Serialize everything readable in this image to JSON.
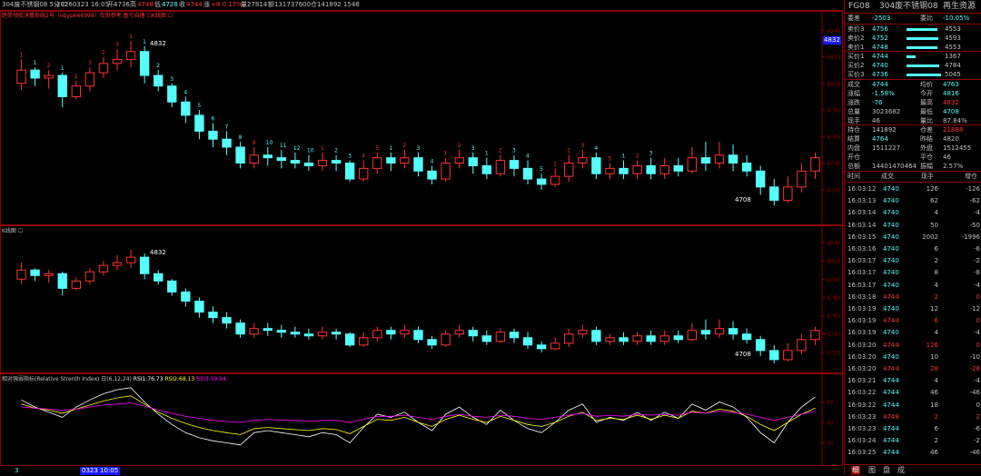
{
  "topbar": {
    "title": "304废不锈钢08 5分 ☐",
    "date": "20260323 16:05",
    "open": "开4736",
    "high_label": "高",
    "high": "4748",
    "low_label": "低",
    "low": "4728",
    "close_label": "收",
    "close": "4744",
    "change_label": "涨",
    "change": "+8 0.17%",
    "volume": "量27814",
    "amount": "额131737600",
    "oi": "仓141892 1548"
  },
  "panel1": {
    "legend": "趋势领航决策系统2号（nbyp666999）仅供参考 盈亏自理 ☐K线图 ☐",
    "high_mark": "4832",
    "low_mark": "4708",
    "current_price": "4832"
  },
  "panel2": {
    "legend": "K线图 ☐",
    "high_mark": "4832",
    "low_mark": "4708"
  },
  "panel3": {
    "legend_name": "相对强弱指标(Relative Strenth Index) 日(6,12,24)",
    "rsi1": "RSI1:76.73",
    "rsi2": "RSI2:68.13",
    "rsi3": "RSI3:59.94"
  },
  "xaxis": {
    "start_label": "3",
    "date_tag": "0323 10:05"
  },
  "colors": {
    "up": "#ff3232",
    "down": "#54ffff",
    "rsi1": "#ffffff",
    "rsi2": "#ffff00",
    "rsi3": "#ff00ff",
    "grid": "#8b0000",
    "text_red": "#ff3232",
    "text_cyan": "#54ffff"
  },
  "side": {
    "code": "FG08",
    "name": "304废不锈钢08",
    "category": "再生资源",
    "wei_cha_label": "委差",
    "wei_cha": "-2503",
    "wei_bi_label": "委比",
    "wei_bi": "-10.05%",
    "asks": [
      {
        "label": "卖价3",
        "price": "4756",
        "vol": "4553"
      },
      {
        "label": "卖价2",
        "price": "4752",
        "vol": "4593"
      },
      {
        "label": "卖价1",
        "price": "4748",
        "vol": "4553"
      }
    ],
    "bids": [
      {
        "label": "买价1",
        "price": "4744",
        "vol": "1367"
      },
      {
        "label": "买价2",
        "price": "4740",
        "vol": "4784"
      },
      {
        "label": "买价3",
        "price": "4736",
        "vol": "5045"
      }
    ],
    "stats": [
      {
        "l1": "成交",
        "v1": "4744",
        "c1": "cyan",
        "l2": "均价",
        "v2": "4763",
        "c2": "cyan"
      },
      {
        "l1": "涨幅",
        "v1": "-1.58%",
        "c1": "cyan",
        "l2": "今开",
        "v2": "4816",
        "c2": "cyan"
      },
      {
        "l1": "涨跌",
        "v1": "-76",
        "c1": "cyan",
        "l2": "最高",
        "v2": "4832",
        "c2": "red"
      },
      {
        "l1": "总量",
        "v1": "3023682",
        "c1": "grey",
        "l2": "最低",
        "v2": "4708",
        "c2": "cyan"
      },
      {
        "l1": "现手",
        "v1": "46",
        "c1": "grey",
        "l2": "量比",
        "v2": "87.84%",
        "c2": "grey"
      }
    ],
    "stats2": [
      {
        "l1": "持仓",
        "v1": "141892",
        "c1": "grey",
        "l2": "仓差",
        "v2": "21888",
        "c2": "red"
      },
      {
        "l1": "结算",
        "v1": "4764",
        "c1": "cyan",
        "l2": "昨结",
        "v2": "4820",
        "c2": "grey"
      },
      {
        "l1": "内盘",
        "v1": "1511227",
        "c1": "grey",
        "l2": "外盘",
        "v2": "1512455",
        "c2": "grey"
      },
      {
        "l1": "开仓",
        "v1": "",
        "c1": "grey",
        "l2": "平仓",
        "v2": "46",
        "c2": "grey"
      },
      {
        "l1": "总额",
        "v1": "14401470464",
        "c1": "grey",
        "l2": "振幅",
        "v2": "2.57%",
        "c2": "grey"
      }
    ],
    "ticks_header": {
      "time": "时间",
      "price": "成交",
      "vol": "现手",
      "oi": "增仓"
    },
    "ticks": [
      {
        "time": "16:03:12",
        "price": "4740",
        "vol": "126",
        "oi": "-126",
        "c": "cyan"
      },
      {
        "time": "16:03:13",
        "price": "4740",
        "vol": "62",
        "oi": "-62",
        "c": "cyan"
      },
      {
        "time": "16:03:14",
        "price": "4740",
        "vol": "4",
        "oi": "-4",
        "c": "cyan"
      },
      {
        "time": "16:03:14",
        "price": "4740",
        "vol": "50",
        "oi": "-50",
        "c": "cyan"
      },
      {
        "time": "16:03:15",
        "price": "4740",
        "vol": "2002",
        "oi": "-1996",
        "c": "cyan"
      },
      {
        "time": "16:03:16",
        "price": "4740",
        "vol": "6",
        "oi": "-6",
        "c": "cyan"
      },
      {
        "time": "16:03:17",
        "price": "4740",
        "vol": "2",
        "oi": "-2",
        "c": "cyan"
      },
      {
        "time": "16:03:17",
        "price": "4740",
        "vol": "8",
        "oi": "-8",
        "c": "cyan"
      },
      {
        "time": "16:03:17",
        "price": "4740",
        "vol": "4",
        "oi": "-4",
        "c": "cyan"
      },
      {
        "time": "16:03:18",
        "price": "4744",
        "vol": "2",
        "oi": "0",
        "c": "red"
      },
      {
        "time": "16:03:19",
        "price": "4740",
        "vol": "12",
        "oi": "-12",
        "c": "cyan"
      },
      {
        "time": "16:03:19",
        "price": "4744",
        "vol": "6",
        "oi": "0",
        "c": "red"
      },
      {
        "time": "16:03:19",
        "price": "4740",
        "vol": "4",
        "oi": "-4",
        "c": "cyan"
      },
      {
        "time": "16:03:20",
        "price": "4744",
        "vol": "126",
        "oi": "0",
        "c": "red"
      },
      {
        "time": "16:03:20",
        "price": "4740",
        "vol": "10",
        "oi": "-10",
        "c": "cyan"
      },
      {
        "time": "16:03:20",
        "price": "4744",
        "vol": "28",
        "oi": "-28",
        "c": "red"
      },
      {
        "time": "16:03:21",
        "price": "4744",
        "vol": "4",
        "oi": "-4",
        "c": "cyan"
      },
      {
        "time": "16:03:22",
        "price": "4744",
        "vol": "46",
        "oi": "-46",
        "c": "cyan"
      },
      {
        "time": "16:03:22",
        "price": "4744",
        "vol": "18",
        "oi": "0",
        "c": "cyan"
      },
      {
        "time": "16:03:23",
        "price": "4748",
        "vol": "2",
        "oi": "2",
        "c": "red"
      },
      {
        "time": "16:03:23",
        "price": "4744",
        "vol": "6",
        "oi": "-6",
        "c": "cyan"
      },
      {
        "time": "16:03:24",
        "price": "4744",
        "vol": "2",
        "oi": "-2",
        "c": "cyan"
      },
      {
        "time": "16:03:25",
        "price": "4744",
        "vol": "46",
        "oi": "-46",
        "c": "cyan"
      }
    ],
    "tabs": [
      "细",
      "图",
      "盘",
      "成"
    ]
  },
  "chart_data": {
    "type": "candlestick",
    "y_ticks_main": [
      "4840",
      "4820",
      "4800",
      "4780",
      "4760",
      "4740",
      "4720",
      "4700"
    ],
    "y_ticks_rsi": [
      "60",
      "40",
      "20"
    ],
    "candles": [
      [
        4800,
        4810,
        4795,
        4818
      ],
      [
        4810,
        4804,
        4798,
        4812
      ],
      [
        4804,
        4806,
        4796,
        4810
      ],
      [
        4806,
        4790,
        4782,
        4808
      ],
      [
        4790,
        4798,
        4788,
        4802
      ],
      [
        4798,
        4808,
        4794,
        4812
      ],
      [
        4808,
        4815,
        4804,
        4820
      ],
      [
        4815,
        4818,
        4810,
        4826
      ],
      [
        4818,
        4824,
        4812,
        4832
      ],
      [
        4824,
        4806,
        4800,
        4828
      ],
      [
        4806,
        4798,
        4794,
        4810
      ],
      [
        4798,
        4786,
        4782,
        4800
      ],
      [
        4786,
        4776,
        4770,
        4790
      ],
      [
        4776,
        4764,
        4758,
        4780
      ],
      [
        4764,
        4758,
        4752,
        4770
      ],
      [
        4758,
        4752,
        4746,
        4764
      ],
      [
        4752,
        4740,
        4736,
        4756
      ],
      [
        4740,
        4746,
        4736,
        4752
      ],
      [
        4746,
        4744,
        4738,
        4752
      ],
      [
        4744,
        4742,
        4736,
        4750
      ],
      [
        4742,
        4740,
        4736,
        4748
      ],
      [
        4740,
        4738,
        4734,
        4746
      ],
      [
        4738,
        4742,
        4734,
        4748
      ],
      [
        4742,
        4740,
        4734,
        4746
      ],
      [
        4740,
        4728,
        4726,
        4742
      ],
      [
        4728,
        4736,
        4726,
        4742
      ],
      [
        4736,
        4744,
        4732,
        4748
      ],
      [
        4744,
        4740,
        4734,
        4748
      ],
      [
        4740,
        4744,
        4736,
        4750
      ],
      [
        4744,
        4734,
        4730,
        4748
      ],
      [
        4734,
        4728,
        4724,
        4738
      ],
      [
        4728,
        4740,
        4726,
        4744
      ],
      [
        4740,
        4744,
        4736,
        4750
      ],
      [
        4744,
        4738,
        4732,
        4748
      ],
      [
        4738,
        4732,
        4728,
        4744
      ],
      [
        4732,
        4742,
        4730,
        4746
      ],
      [
        4742,
        4736,
        4730,
        4746
      ],
      [
        4736,
        4728,
        4724,
        4742
      ],
      [
        4728,
        4724,
        4720,
        4732
      ],
      [
        4724,
        4730,
        4722,
        4736
      ],
      [
        4730,
        4740,
        4726,
        4746
      ],
      [
        4740,
        4744,
        4736,
        4750
      ],
      [
        4744,
        4732,
        4728,
        4748
      ],
      [
        4732,
        4736,
        4728,
        4740
      ],
      [
        4736,
        4732,
        4728,
        4742
      ],
      [
        4732,
        4738,
        4728,
        4742
      ],
      [
        4738,
        4732,
        4728,
        4744
      ],
      [
        4732,
        4738,
        4728,
        4744
      ],
      [
        4738,
        4734,
        4730,
        4744
      ],
      [
        4734,
        4744,
        4732,
        4752
      ],
      [
        4744,
        4740,
        4734,
        4756
      ],
      [
        4740,
        4746,
        4736,
        4756
      ],
      [
        4746,
        4740,
        4734,
        4754
      ],
      [
        4740,
        4734,
        4730,
        4746
      ],
      [
        4734,
        4722,
        4716,
        4738
      ],
      [
        4722,
        4712,
        4708,
        4728
      ],
      [
        4712,
        4722,
        4710,
        4730
      ],
      [
        4722,
        4734,
        4718,
        4740
      ],
      [
        4734,
        4744,
        4728,
        4748
      ]
    ],
    "rsi1": [
      62,
      55,
      50,
      45,
      55,
      62,
      68,
      72,
      74,
      60,
      48,
      38,
      30,
      25,
      22,
      20,
      18,
      30,
      32,
      30,
      28,
      26,
      30,
      28,
      20,
      35,
      48,
      45,
      50,
      40,
      32,
      48,
      55,
      45,
      38,
      52,
      42,
      34,
      30,
      40,
      52,
      58,
      40,
      45,
      42,
      50,
      42,
      50,
      44,
      58,
      52,
      60,
      55,
      45,
      30,
      20,
      40,
      55,
      65
    ],
    "rsi2": [
      58,
      54,
      52,
      49,
      53,
      57,
      61,
      64,
      66,
      58,
      50,
      44,
      39,
      35,
      32,
      30,
      28,
      34,
      35,
      34,
      33,
      32,
      34,
      33,
      29,
      36,
      43,
      42,
      45,
      40,
      36,
      43,
      47,
      43,
      40,
      46,
      42,
      38,
      36,
      40,
      46,
      50,
      42,
      44,
      43,
      47,
      43,
      47,
      44,
      51,
      49,
      53,
      51,
      46,
      38,
      32,
      40,
      48,
      54
    ],
    "rsi3": [
      55,
      54,
      53,
      52,
      53,
      55,
      57,
      58,
      59,
      56,
      52,
      49,
      46,
      44,
      42,
      41,
      40,
      42,
      43,
      42,
      42,
      41,
      42,
      42,
      40,
      43,
      46,
      46,
      47,
      45,
      43,
      46,
      48,
      46,
      45,
      47,
      46,
      44,
      43,
      45,
      47,
      49,
      46,
      47,
      46,
      48,
      47,
      48,
      47,
      50,
      49,
      51,
      50,
      48,
      45,
      42,
      45,
      48,
      51
    ],
    "markers_top": [
      "1",
      "1",
      "2",
      "1",
      "1",
      "3",
      "2",
      "3",
      "1",
      "1",
      "2",
      "3",
      "4",
      "5",
      "6",
      "7",
      "8",
      "9",
      "10",
      "11",
      "12",
      "10",
      "1",
      "2",
      "3",
      "4",
      "5",
      "1",
      "2",
      "3",
      "4",
      "1",
      "2",
      "3",
      "1",
      "2",
      "3",
      "4",
      "5",
      "1",
      "2",
      "3",
      "4",
      "5",
      "1",
      "2",
      "3"
    ]
  }
}
